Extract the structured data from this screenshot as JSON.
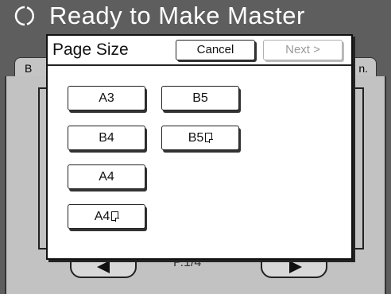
{
  "status": {
    "icon": "busy-circle-icon",
    "text": "Ready to Make Master"
  },
  "background": {
    "tab_left": "B",
    "tab_right": "n.",
    "page_indicator": "P.1/4"
  },
  "dialog": {
    "title": "Page Size",
    "cancel_label": "Cancel",
    "next_label": "Next >",
    "next_enabled": false,
    "sizes": {
      "a3": "A3",
      "b5": "B5",
      "b4": "B4",
      "b5_rotated": "B5",
      "a4": "A4",
      "a4_rotated": "A4"
    }
  }
}
